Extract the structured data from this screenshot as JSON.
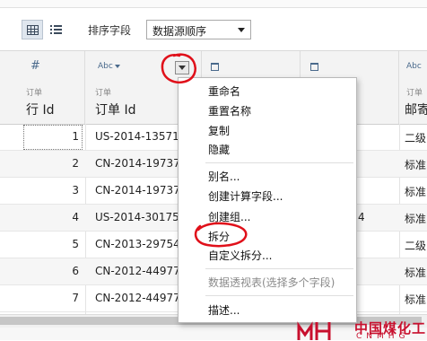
{
  "toolbar": {
    "sort_label": "排序字段",
    "sort_value": "数据源顺序"
  },
  "columns": [
    {
      "type_icon": "#",
      "source": "订单",
      "name": "行 Id"
    },
    {
      "type_icon": "Abc",
      "source": "订单",
      "name": "订单 Id"
    },
    {
      "type_icon": "calendar-icon",
      "source": "",
      "name": ""
    },
    {
      "type_icon": "calendar-icon",
      "source": "",
      "name": ""
    },
    {
      "type_icon": "Abc",
      "source": "订单",
      "name": "邮寄"
    }
  ],
  "rows": [
    {
      "row_id": "1",
      "order_id": "US-2014-13571",
      "c3": "",
      "c4": "",
      "ship": "二级"
    },
    {
      "row_id": "2",
      "order_id": "CN-2014-19737",
      "c3": "",
      "c4": "",
      "ship": "标准"
    },
    {
      "row_id": "3",
      "order_id": "CN-2014-19737",
      "c3": "",
      "c4": "",
      "ship": "标准"
    },
    {
      "row_id": "4",
      "order_id": "US-2014-30175",
      "c3": "",
      "c4": "4",
      "ship": "标准"
    },
    {
      "row_id": "5",
      "order_id": "CN-2013-29754",
      "c3": "",
      "c4": "",
      "ship": "二级"
    },
    {
      "row_id": "6",
      "order_id": "CN-2012-44977",
      "c3": "",
      "c4": "",
      "ship": "标准"
    },
    {
      "row_id": "7",
      "order_id": "CN-2012-44977",
      "c3": "",
      "c4": "",
      "ship": "标准"
    }
  ],
  "menu": {
    "items": [
      "重命名",
      "重置名称",
      "复制",
      "隐藏",
      "别名...",
      "创建计算字段...",
      "创建组...",
      "拆分",
      "自定义拆分...",
      "数据透视表(选择多个字段)",
      "描述..."
    ]
  },
  "watermark": {
    "cn": "中国煤化工",
    "en": "CNMHG"
  },
  "colors": {
    "annotation": "#e0101a",
    "logo": "#c8102e"
  }
}
